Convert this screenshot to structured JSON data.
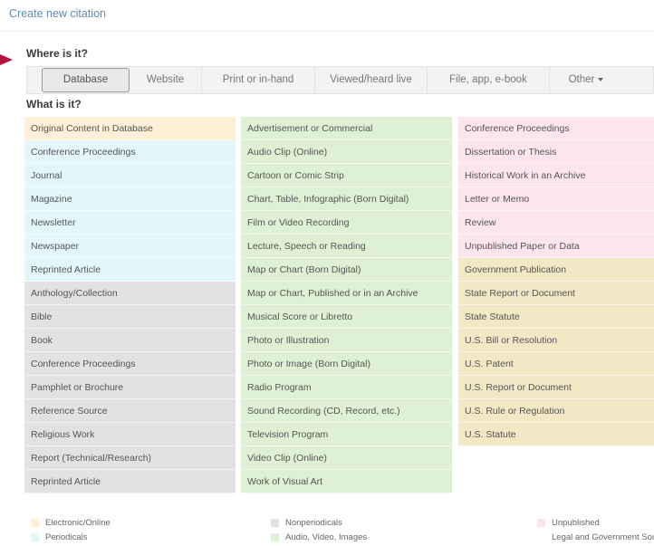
{
  "header": {
    "create_new_citation": "Create new citation"
  },
  "where": {
    "label": "Where is it?",
    "tabs": [
      {
        "label": "Database",
        "active": true
      },
      {
        "label": "Website"
      },
      {
        "label": "Print or in-hand"
      },
      {
        "label": "Viewed/heard live"
      },
      {
        "label": "File, app, e-book"
      },
      {
        "label": "Other"
      }
    ]
  },
  "what": {
    "label": "What is it?",
    "columns": [
      [
        {
          "label": "Original Content in Database",
          "category": "electronic"
        },
        {
          "label": "Conference Proceedings",
          "category": "periodicals"
        },
        {
          "label": "Journal",
          "category": "periodicals"
        },
        {
          "label": "Magazine",
          "category": "periodicals"
        },
        {
          "label": "Newsletter",
          "category": "periodicals"
        },
        {
          "label": "Newspaper",
          "category": "periodicals"
        },
        {
          "label": "Reprinted Article",
          "category": "periodicals"
        },
        {
          "label": "Anthology/Collection",
          "category": "nonperiodicals"
        },
        {
          "label": "Bible",
          "category": "nonperiodicals"
        },
        {
          "label": "Book",
          "category": "nonperiodicals"
        },
        {
          "label": "Conference Proceedings",
          "category": "nonperiodicals"
        },
        {
          "label": "Pamphlet or Brochure",
          "category": "nonperiodicals"
        },
        {
          "label": "Reference Source",
          "category": "nonperiodicals"
        },
        {
          "label": "Religious Work",
          "category": "nonperiodicals"
        },
        {
          "label": "Report (Technical/Research)",
          "category": "nonperiodicals"
        },
        {
          "label": "Reprinted Article",
          "category": "nonperiodicals"
        }
      ],
      [
        {
          "label": "Advertisement or Commercial",
          "category": "audio"
        },
        {
          "label": "Audio Clip (Online)",
          "category": "audio"
        },
        {
          "label": "Cartoon or Comic Strip",
          "category": "audio"
        },
        {
          "label": "Chart, Table, Infographic (Born Digital)",
          "category": "audio"
        },
        {
          "label": "Film or Video Recording",
          "category": "audio"
        },
        {
          "label": "Lecture, Speech or Reading",
          "category": "audio"
        },
        {
          "label": "Map or Chart (Born Digital)",
          "category": "audio"
        },
        {
          "label": "Map or Chart, Published or in an Archive",
          "category": "audio"
        },
        {
          "label": "Musical Score or Libretto",
          "category": "audio"
        },
        {
          "label": "Photo or Illustration",
          "category": "audio"
        },
        {
          "label": "Photo or Image (Born Digital)",
          "category": "audio"
        },
        {
          "label": "Radio Program",
          "category": "audio"
        },
        {
          "label": "Sound Recording (CD, Record, etc.)",
          "category": "audio"
        },
        {
          "label": "Television Program",
          "category": "audio"
        },
        {
          "label": "Video Clip (Online)",
          "category": "audio"
        },
        {
          "label": "Work of Visual Art",
          "category": "audio"
        }
      ],
      [
        {
          "label": "Conference Proceedings",
          "category": "unpublished"
        },
        {
          "label": "Dissertation or Thesis",
          "category": "unpublished"
        },
        {
          "label": "Historical Work in an Archive",
          "category": "unpublished"
        },
        {
          "label": "Letter or Memo",
          "category": "unpublished"
        },
        {
          "label": "Review",
          "category": "unpublished"
        },
        {
          "label": "Unpublished Paper or Data",
          "category": "unpublished"
        },
        {
          "label": "Government Publication",
          "category": "legal"
        },
        {
          "label": "State Report or Document",
          "category": "legal"
        },
        {
          "label": "State Statute",
          "category": "legal"
        },
        {
          "label": "U.S. Bill or Resolution",
          "category": "legal"
        },
        {
          "label": "U.S. Patent",
          "category": "legal"
        },
        {
          "label": "U.S. Report or Document",
          "category": "legal"
        },
        {
          "label": "U.S. Rule or Regulation",
          "category": "legal"
        },
        {
          "label": "U.S. Statute",
          "category": "legal"
        }
      ]
    ]
  },
  "legend": [
    {
      "label": "Electronic/Online",
      "category": "electronic"
    },
    {
      "label": "Periodicals",
      "category": "periodicals"
    },
    {
      "label": "Nonperiodicals",
      "category": "nonperiodicals"
    },
    {
      "label": "Audio, Video, Images",
      "category": "audio"
    },
    {
      "label": "Unpublished",
      "category": "unpublished"
    },
    {
      "label": "Legal and Government Sources",
      "category": "legal"
    }
  ],
  "colors": {
    "electronic": "#fdf0d6",
    "periodicals": "#e3f7fb",
    "nonperiodicals": "#e2e2e2",
    "audio": "#dff1d4",
    "unpublished": "#fce6ec",
    "legal": "#f2e8c5",
    "arrow": "#b3133a"
  }
}
